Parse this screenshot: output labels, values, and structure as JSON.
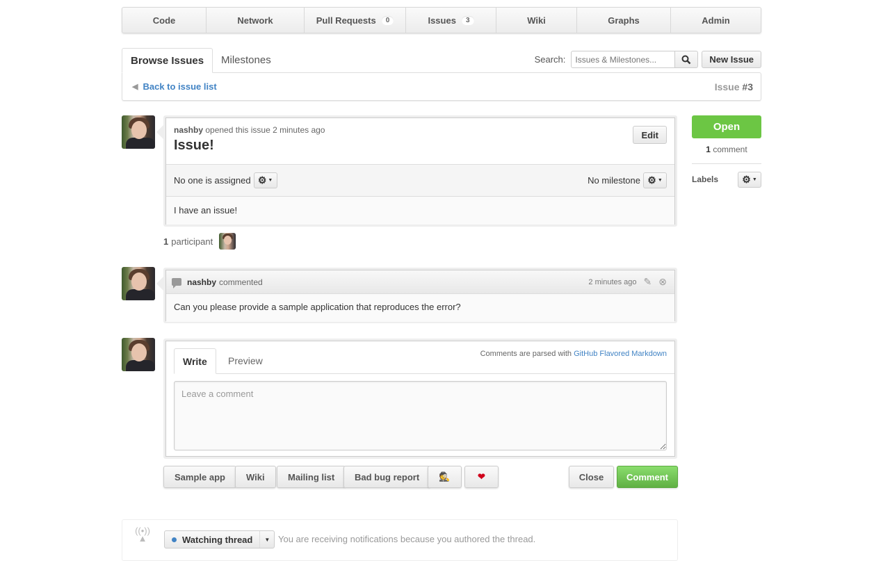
{
  "nav": {
    "items": [
      {
        "label": "Code",
        "count": null
      },
      {
        "label": "Network",
        "count": null
      },
      {
        "label": "Pull Requests",
        "count": "0"
      },
      {
        "label": "Issues",
        "count": "3"
      },
      {
        "label": "Wiki",
        "count": null
      },
      {
        "label": "Graphs",
        "count": null
      },
      {
        "label": "Admin",
        "count": null
      }
    ]
  },
  "tabs": {
    "browse": "Browse Issues",
    "milestones": "Milestones"
  },
  "search": {
    "label": "Search:",
    "placeholder": "Issues & Milestones...",
    "icon": "search-icon"
  },
  "new_issue_label": "New Issue",
  "back_link": "Back to issue list",
  "issue_number_prefix": "Issue",
  "issue_number": "#3",
  "issue": {
    "author": "nashby",
    "meta": "opened this issue 2 minutes ago",
    "title": "Issue!",
    "edit_label": "Edit",
    "assignee_text": "No one is assigned",
    "milestone_text": "No milestone",
    "body": "I have an issue!"
  },
  "participants": {
    "count": "1",
    "label": "participant"
  },
  "comment": {
    "author": "nashby",
    "action": "commented",
    "time": "2 minutes ago",
    "body": "Can you please provide a sample application that reproduces the error?"
  },
  "sidebar": {
    "state": "Open",
    "state_color": "#6cc644",
    "comment_count": "1",
    "comment_label": "comment",
    "labels_title": "Labels"
  },
  "composer": {
    "write_tab": "Write",
    "preview_tab": "Preview",
    "markdown_note": "Comments are parsed with",
    "markdown_link": "GitHub Flavored Markdown",
    "placeholder": "Leave a comment"
  },
  "canned_buttons": [
    {
      "label": "Sample app"
    },
    {
      "label": "Wiki"
    },
    {
      "label": "Mailing list"
    },
    {
      "label": "Bad bug report"
    },
    {
      "label": "🕵"
    },
    {
      "label": "❤"
    }
  ],
  "close_label": "Close",
  "comment_label": "Comment",
  "watch": {
    "button_label": "Watching thread",
    "note": "You are receiving notifications because you authored the thread."
  }
}
